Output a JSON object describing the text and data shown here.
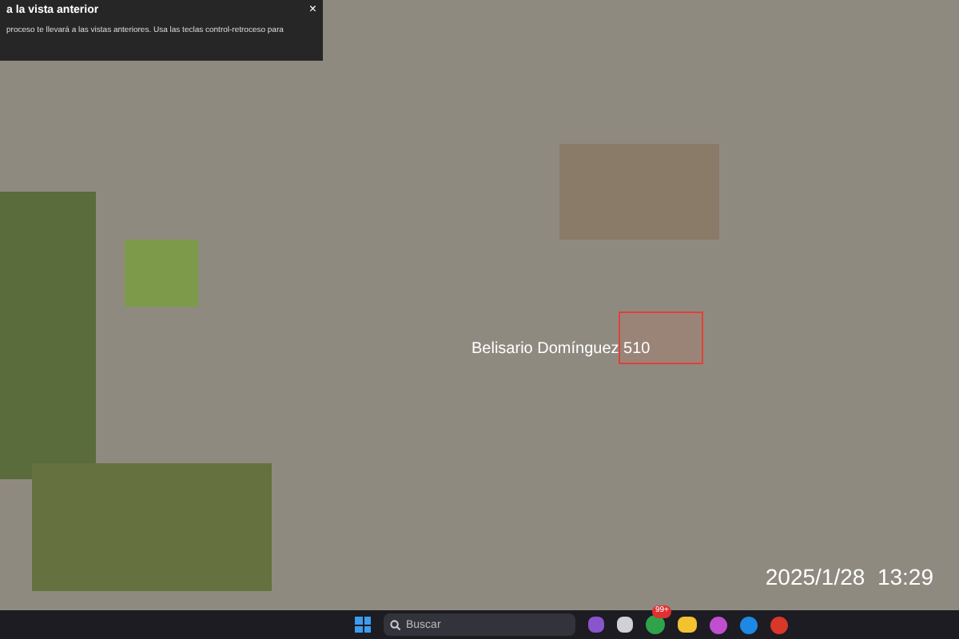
{
  "tooltip": {
    "title": "a la vista anterior",
    "body": "proceso te llevará a las vistas anteriores. Usa las teclas control-retroceso para",
    "close": "×"
  },
  "map": {
    "place_label": "Belisario Domínguez 510"
  },
  "timestamp": "2025/1/28  13:29",
  "taskbar": {
    "search": {
      "placeholder": "Buscar"
    },
    "badge": "99+"
  }
}
